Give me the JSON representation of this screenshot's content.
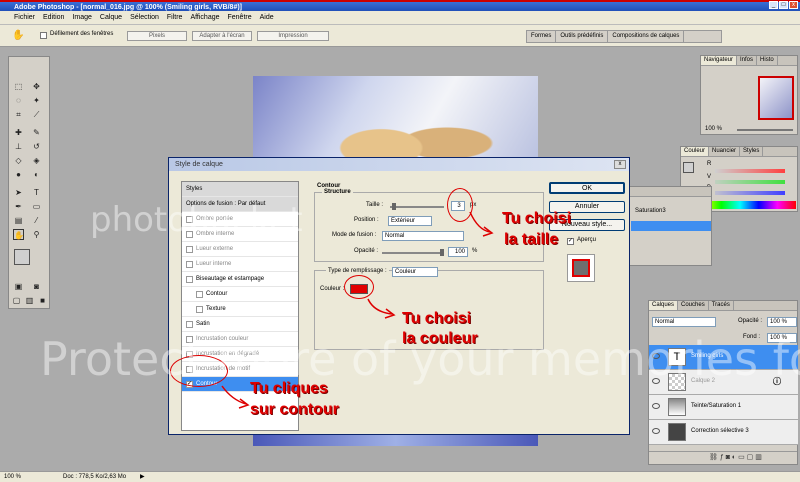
{
  "window": {
    "title": "Adobe Photoshop - [normal_016.jpg @ 100% (Smiling girls, RVB/8#)]",
    "btn_min": "_",
    "btn_max": "□",
    "btn_close": "x"
  },
  "menu": [
    "Fichier",
    "Edition",
    "Image",
    "Calque",
    "Sélection",
    "Filtre",
    "Affichage",
    "Fenêtre",
    "Aide"
  ],
  "options": {
    "scroll_all": "Défilement des fenêtres",
    "pixels": "Pixels",
    "fit_screen": "Adapter à l'écran",
    "print": "Impression"
  },
  "palette_well": [
    "Formes",
    "Outils prédéfinis",
    "Compositions de calques"
  ],
  "navigator": {
    "tabs": [
      "Navigateur",
      "Infos",
      "Histo"
    ],
    "zoom": "100 %"
  },
  "color_panel": {
    "tabs": [
      "Couleur",
      "Nuancier",
      "Styles"
    ],
    "r": "R",
    "v": "V",
    "b": "B"
  },
  "calques_small": {
    "label": "Saturation3"
  },
  "dialog": {
    "title": "Style de calque",
    "close": "x",
    "styles_list": {
      "header": "Styles",
      "fusion": "Options de fusion : Par défaut",
      "items": [
        "Ombre portée",
        "Ombre interne",
        "Lueur externe",
        "Lueur interne",
        "Biseautage et estampage",
        "Contour",
        "Texture",
        "Satin",
        "Incrustation couleur",
        "Incrustation en dégradé",
        "Incrustation de motif",
        "Contour"
      ]
    },
    "contour": {
      "section": "Contour",
      "structure": "Structure",
      "taille_label": "Taille :",
      "taille_value": "3",
      "taille_unit": "px",
      "position_label": "Position :",
      "position_value": "Extérieur",
      "mode_label": "Mode de fusion :",
      "mode_value": "Normal",
      "opacite_label": "Opacité :",
      "opacite_value": "100",
      "opacite_unit": "%",
      "fill_type_label": "Type de remplissage :",
      "fill_type_value": "Couleur",
      "couleur_label": "Couleur :",
      "color_hex": "#e00000"
    },
    "buttons": {
      "ok": "OK",
      "cancel": "Annuler",
      "new_style": "Nouveau style...",
      "preview": "Aperçu"
    }
  },
  "annotations": {
    "taille_1": "Tu choisi",
    "taille_2": "la taille",
    "couleur_1": "Tu choisi",
    "couleur_2": "la couleur",
    "contour_1": "Tu cliques",
    "contour_2": "sur contour"
  },
  "layers": {
    "tabs": [
      "Calques",
      "Couches",
      "Tracés"
    ],
    "blend": "Normal",
    "opacity_label": "Opacité :",
    "opacity": "100 %",
    "fill_label": "Fond :",
    "fill": "100 %",
    "rows": [
      "Smiling girls",
      "Calque 2",
      "Teinte/Saturation 1",
      "Correction sélective 3"
    ]
  },
  "status": {
    "zoom": "100 %",
    "doc": "Doc : 778,5 Ko/2,63 Mo"
  },
  "watermark": {
    "line1": "photobucket",
    "line2": "Protect more of your memories for less!"
  }
}
